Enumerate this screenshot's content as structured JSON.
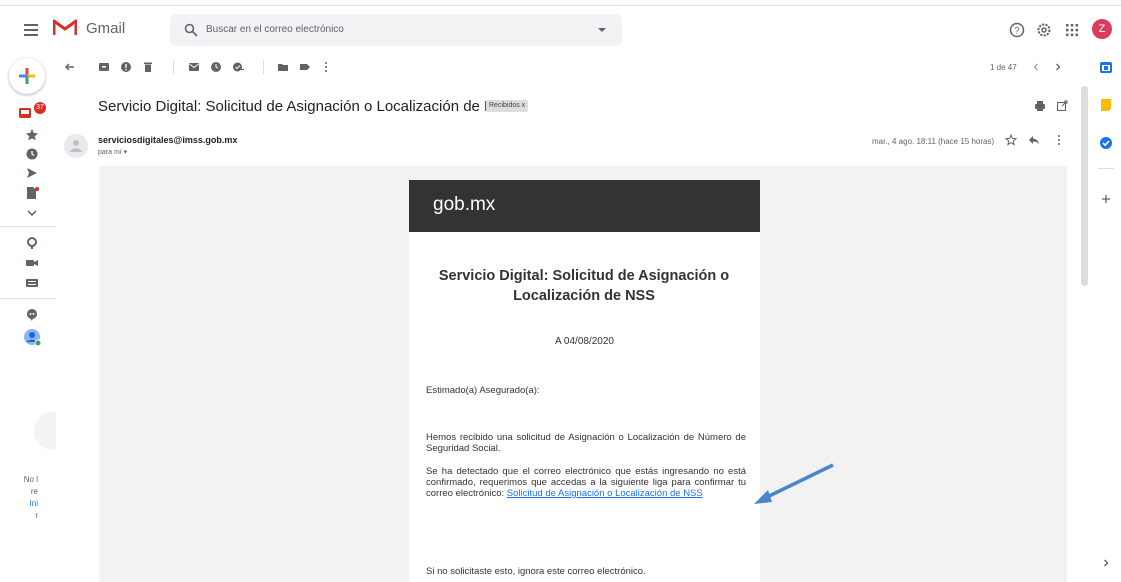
{
  "header": {
    "app_name": "Gmail",
    "search_placeholder": "Buscar en el correo electrónico",
    "avatar_letter": "Z",
    "colors": {
      "red": "#d93025",
      "blue": "#4285f4",
      "yellow": "#fbbc04",
      "green": "#34a853"
    }
  },
  "sidebar": {
    "inbox_badge": "37",
    "fragments": [
      "No l",
      "re",
      "Ini",
      "r"
    ]
  },
  "toolbar": {
    "pager": "1 de 47"
  },
  "message": {
    "subject": "Servicio Digital: Solicitud de Asignación o Localización de NSS",
    "label": "Recibidos x",
    "sender": "serviciosdigitales@imss.gob.mx",
    "recipient": "para mí ▾",
    "date": "mar., 4 ago. 18:11 (hace 15 horas)"
  },
  "body": {
    "brand": "gob.mx",
    "title": "Servicio Digital: Solicitud de Asignación o Localización de NSS",
    "date": "A 04/08/2020",
    "greeting": "Estimado(a) Asegurado(a):",
    "p1": "Hemos recibido una solicitud de Asignación o Localización de Número de Seguridad Social.",
    "p2": "Se ha detectado que el correo electrónico que estás ingresando no está confirmado, requerimos que accedas a la siguiente liga para confirmar tu correo electrónico: ",
    "link": "Solicitud de Asignación o Localización de NSS",
    "p3": "Si no solicitaste esto, ignora este correo electrónico."
  }
}
